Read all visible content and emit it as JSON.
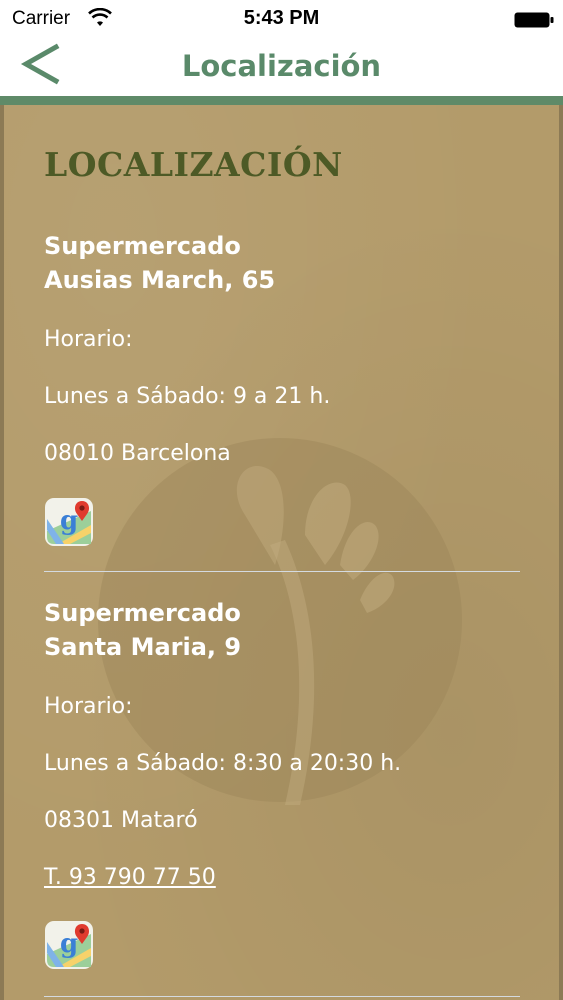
{
  "status_bar": {
    "carrier": "Carrier",
    "time": "5:43 PM",
    "icons": [
      "wifi-icon",
      "battery-icon"
    ]
  },
  "nav": {
    "title": "Localización",
    "back_icon": "chevron-left-icon",
    "accent_color": "#5a8a6a"
  },
  "section": {
    "title": "LOCALIZACIÓN"
  },
  "stores": [
    {
      "name_line1": "Supermercado",
      "name_line2": "Ausias March, 65",
      "schedule_label": "Horario:",
      "schedule": "Lunes a Sábado: 9 a 21 h.",
      "address": "08010 Barcelona",
      "map_icon": "google-maps-icon"
    },
    {
      "name_line1": "Supermercado",
      "name_line2": "Santa Maria, 9",
      "schedule_label": "Horario:",
      "schedule": "Lunes a Sábado: 8:30 a 20:30 h.",
      "address": "08301 Mataró",
      "phone": "T. 93 790 77 50",
      "map_icon": "google-maps-icon"
    }
  ],
  "colors": {
    "background": "#b39b6a",
    "title_color": "#4d5a26",
    "header_rule": "#5f8a68"
  }
}
